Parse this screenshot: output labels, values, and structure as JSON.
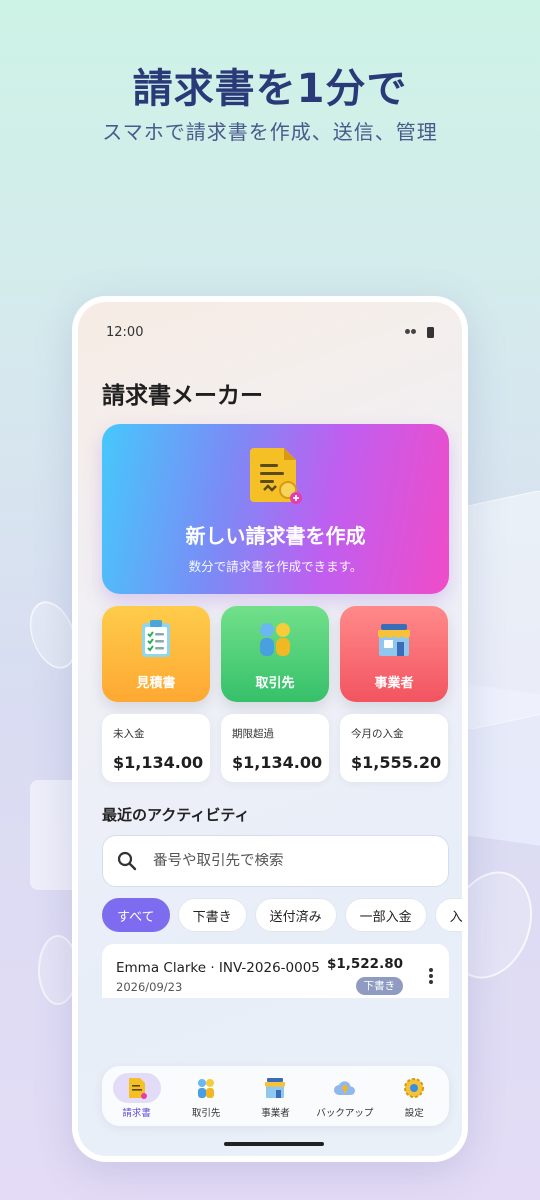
{
  "promo": {
    "headline": "請求書を1分で",
    "subheadline": "スマホで請求書を作成、送信、管理"
  },
  "statusbar": {
    "time": "12:00",
    "icons": [
      "signal-icon",
      "battery-icon"
    ]
  },
  "app": {
    "title": "請求書メーカー"
  },
  "hero": {
    "title": "新しい請求書を作成",
    "subtitle": "数分で請求書を作成できます。",
    "icon": "invoice-add-icon"
  },
  "tiles": [
    {
      "label": "見積書",
      "icon": "clipboard-icon",
      "color": "#fda832"
    },
    {
      "label": "取引先",
      "icon": "people-icon",
      "color": "#36c06a"
    },
    {
      "label": "事業者",
      "icon": "store-icon",
      "color": "#f25460"
    }
  ],
  "stats": [
    {
      "label": "未入金",
      "value": "$1,134.00"
    },
    {
      "label": "期限超過",
      "value": "$1,134.00"
    },
    {
      "label": "今月の入金",
      "value": "$1,555.20"
    }
  ],
  "recent": {
    "title": "最近のアクティビティ",
    "search_placeholder": "番号や取引先で検索",
    "filters": [
      "すべて",
      "下書き",
      "送付済み",
      "一部入金",
      "入金"
    ],
    "active_filter": "すべて",
    "items": [
      {
        "title": "Emma Clarke · INV-2026-0005",
        "date": "2026/09/23",
        "amount": "$1,522.80",
        "status": "下書き"
      }
    ]
  },
  "bottom_nav": [
    {
      "label": "請求書",
      "icon": "invoice-icon",
      "active": true
    },
    {
      "label": "取引先",
      "icon": "people-icon",
      "active": false
    },
    {
      "label": "事業者",
      "icon": "store-icon",
      "active": false
    },
    {
      "label": "バックアップ",
      "icon": "cloud-upload-icon",
      "active": false
    },
    {
      "label": "設定",
      "icon": "gear-icon",
      "active": false
    }
  ],
  "colors": {
    "accent": "#7d6cf0",
    "headline": "#2a3a78",
    "badge": "#8f9bc0"
  }
}
